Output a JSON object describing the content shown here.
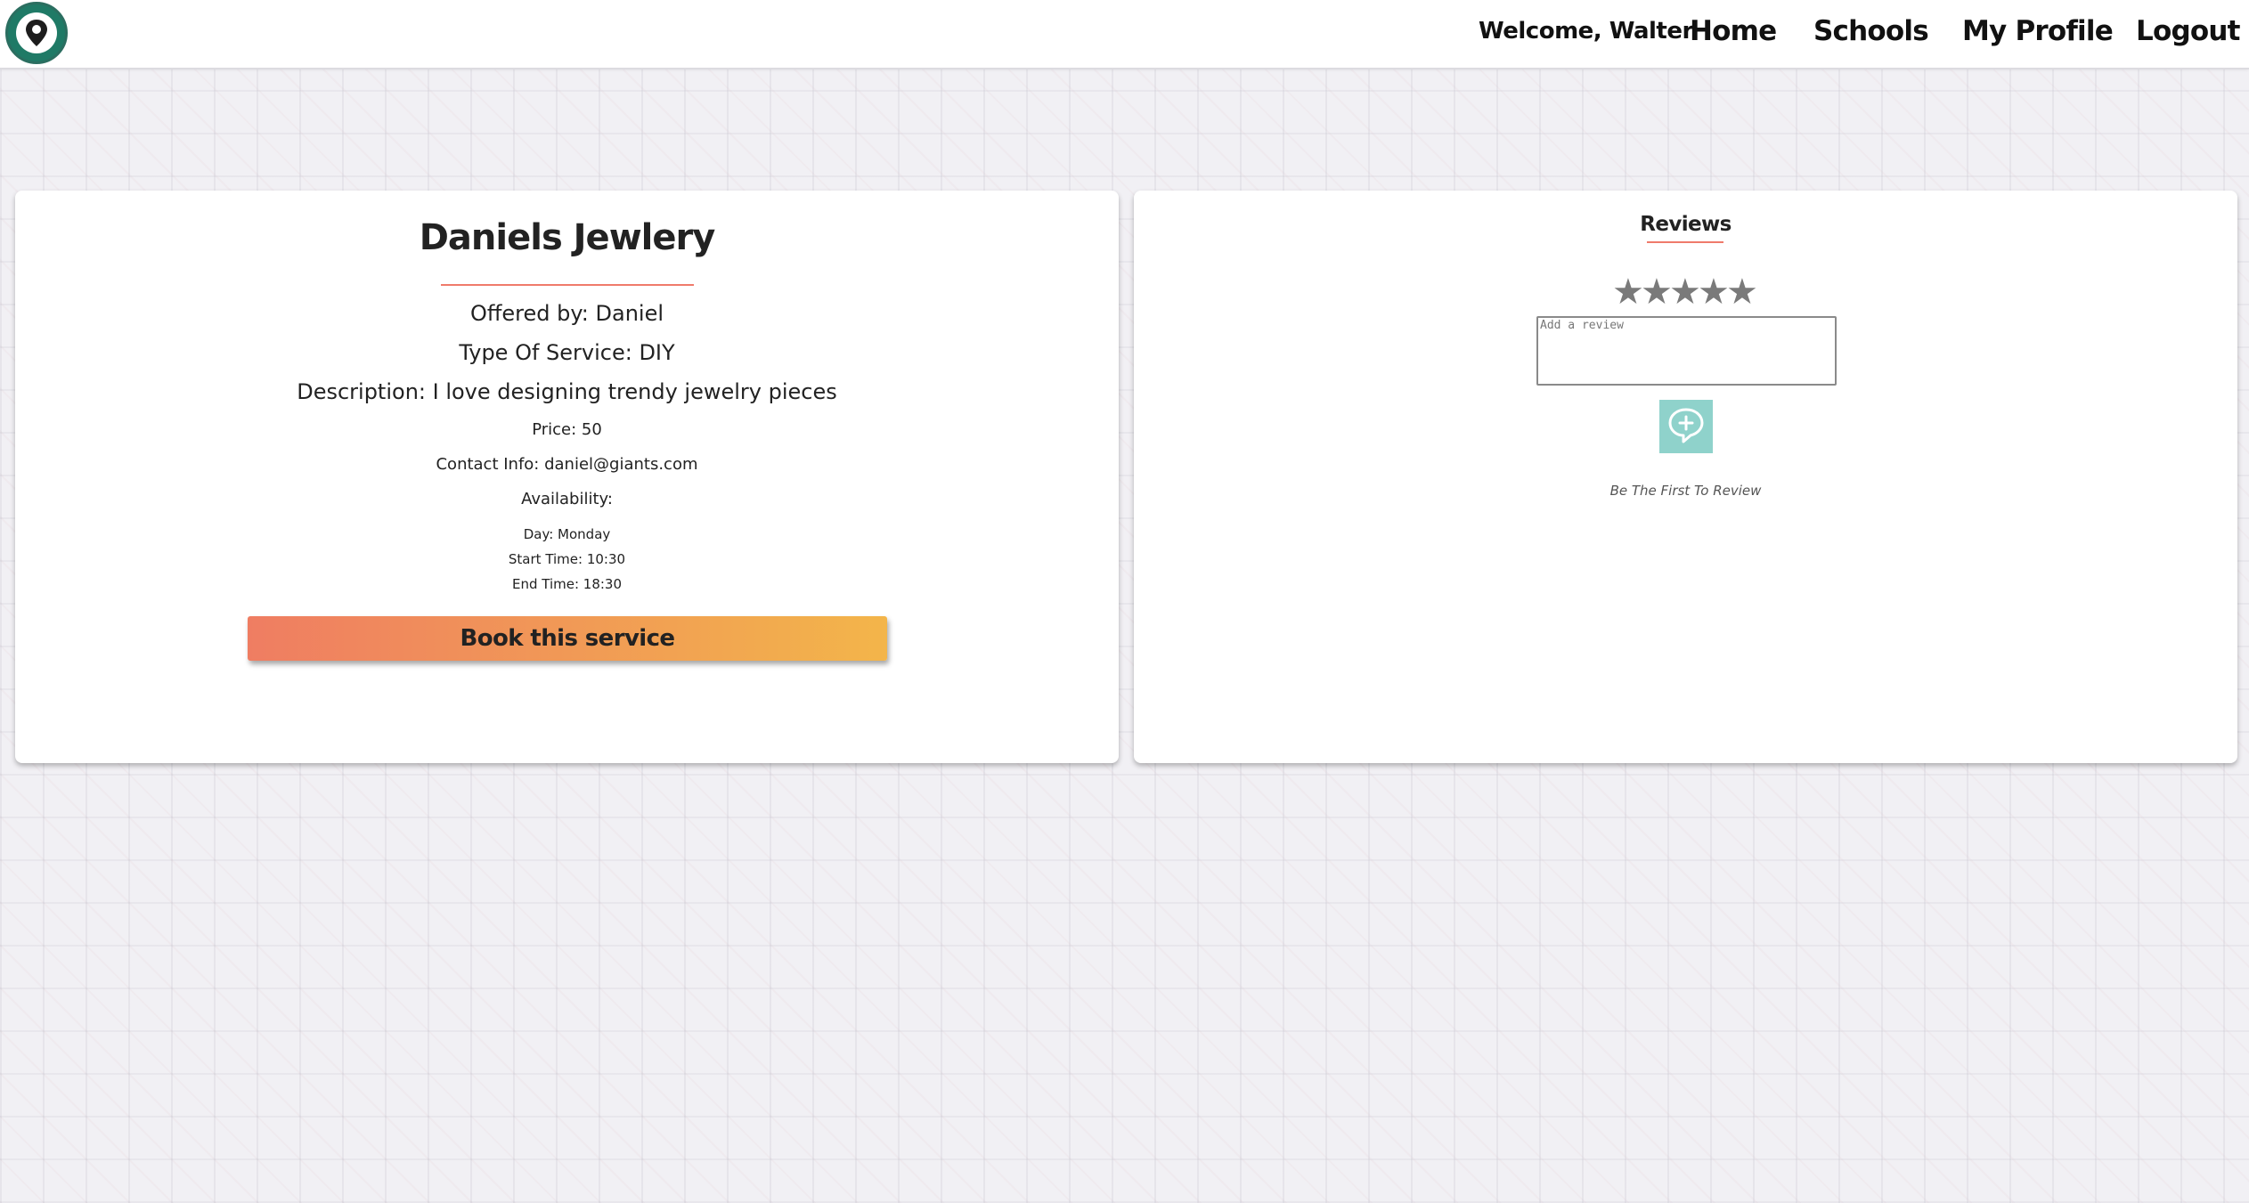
{
  "header": {
    "logo": "campus-services-logo",
    "welcome": "Welcome, Walter",
    "nav": [
      {
        "label": "Home"
      },
      {
        "label": "Schools"
      },
      {
        "label": "My Profile"
      },
      {
        "label": "Logout"
      }
    ]
  },
  "service": {
    "title": "Daniels Jewlery",
    "offered_by": "Offered by: Daniel",
    "type": "Type Of Service: DIY",
    "description": "Description: I love designing trendy jewelry pieces",
    "price": "Price: 50",
    "contact": "Contact Info: daniel@giants.com",
    "availability_label": "Availability:",
    "day": "Day: Monday",
    "start_time": "Start Time: 10:30",
    "end_time": "End Time: 18:30",
    "book_label": "Book this service"
  },
  "reviews": {
    "title": "Reviews",
    "stars": [
      "★",
      "★",
      "★",
      "★",
      "★"
    ],
    "rating": 0,
    "placeholder": "Add a review",
    "add_icon": "add-comment-icon",
    "empty_text": "Be The First To Review"
  },
  "colors": {
    "accent_rule": "#ef7a6b",
    "button_gradient_start": "#ef7d62",
    "button_gradient_end": "#f3b54a",
    "add_review_button": "#8fd2cb",
    "star": "#7a7a7a"
  }
}
